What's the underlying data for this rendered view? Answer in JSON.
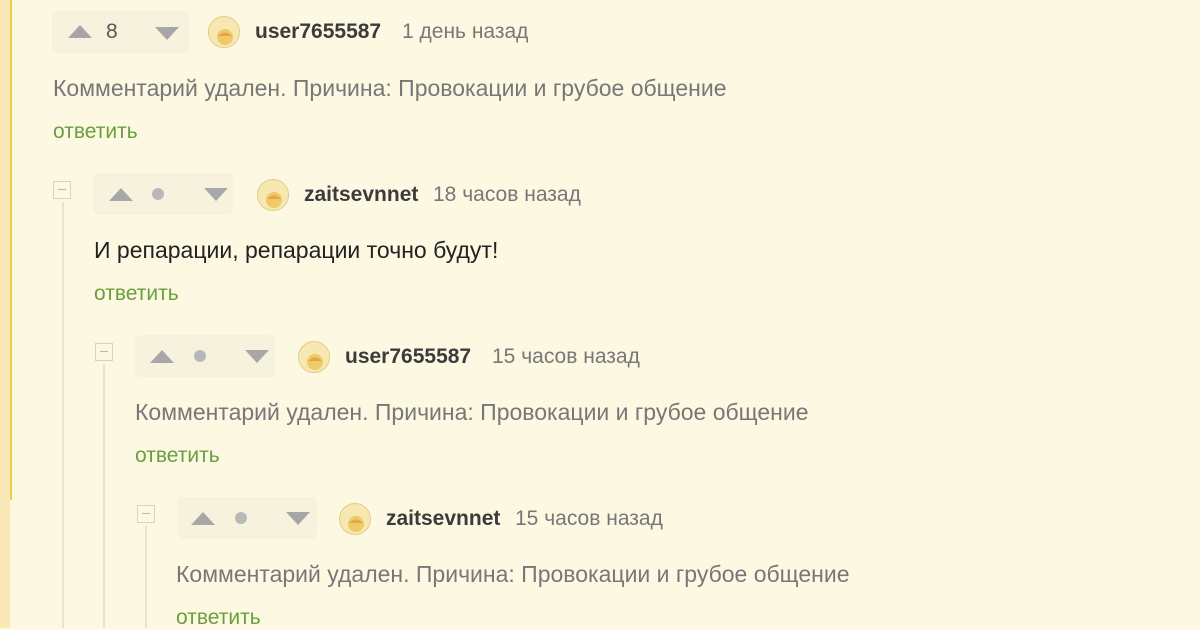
{
  "comments": [
    {
      "rating": "8",
      "username": "user7655587",
      "time": "1 день назад",
      "text": "Комментарий удален. Причина: Провокации и грубое общение",
      "reply_label": "ответить"
    },
    {
      "username": "zaitsevnnet",
      "time": "18 часов назад",
      "text": "И репарации, репарации точно будут!",
      "reply_label": "ответить"
    },
    {
      "username": "user7655587",
      "time": "15 часов назад",
      "text": "Комментарий удален. Причина: Провокации и грубое общение",
      "reply_label": "ответить"
    },
    {
      "username": "zaitsevnnet",
      "time": "15 часов назад",
      "text": "Комментарий удален. Причина: Провокации и грубое общение",
      "reply_label": "ответить"
    }
  ],
  "icons": {
    "upvote": "upvote-arrow-icon",
    "downvote": "downvote-arrow-icon",
    "collapse": "collapse-minus-icon",
    "avatar": "default-avatar-icon"
  },
  "colors": {
    "background": "#fdf8e2",
    "reply_link": "#6a9f3d",
    "accent_bar": "#f1cf4e"
  }
}
